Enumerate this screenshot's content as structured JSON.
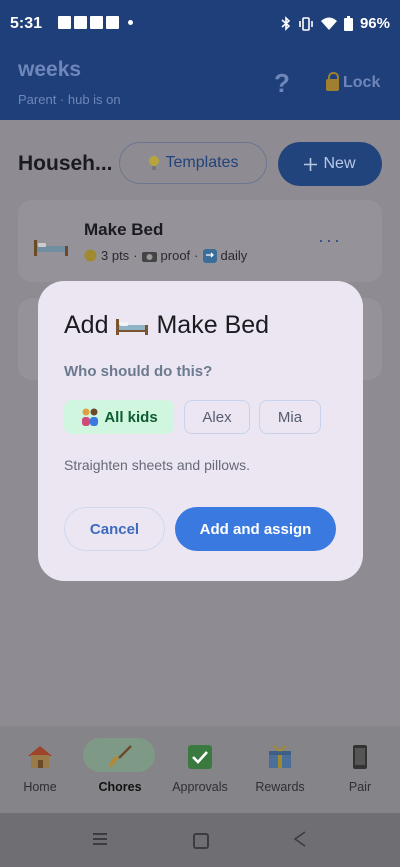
{
  "status_bar": {
    "time": "5:31",
    "battery": "96%"
  },
  "header": {
    "title": "weeks",
    "subtitle": "Parent · hub is on",
    "help_label": "?",
    "lock_label": "Lock"
  },
  "main": {
    "section_title": "Househ...",
    "templates_label": "Templates",
    "new_label": "New",
    "chore": {
      "name": "Make Bed",
      "points": "3 pts",
      "proof": "proof",
      "frequency": "daily",
      "more": "···"
    }
  },
  "dialog": {
    "title_prefix": "Add",
    "title_name": "Make Bed",
    "question": "Who should do this?",
    "chips": [
      {
        "label": "All kids",
        "selected": true
      },
      {
        "label": "Alex",
        "selected": false
      },
      {
        "label": "Mia",
        "selected": false
      }
    ],
    "description": "Straighten sheets and pillows.",
    "cancel_label": "Cancel",
    "confirm_label": "Add and assign"
  },
  "bottom_nav": [
    {
      "label": "Home",
      "icon": "house-icon",
      "active": false
    },
    {
      "label": "Chores",
      "icon": "broom-icon",
      "active": true
    },
    {
      "label": "Approvals",
      "icon": "check-icon",
      "active": false
    },
    {
      "label": "Rewards",
      "icon": "gift-icon",
      "active": false
    },
    {
      "label": "Pair",
      "icon": "phone-icon",
      "active": false
    }
  ],
  "colors": {
    "primary": "#3a7ae0",
    "header": "#1f3f7a",
    "chip_selected_bg": "#d1f6e0",
    "dialog_bg": "#ece6f2"
  }
}
